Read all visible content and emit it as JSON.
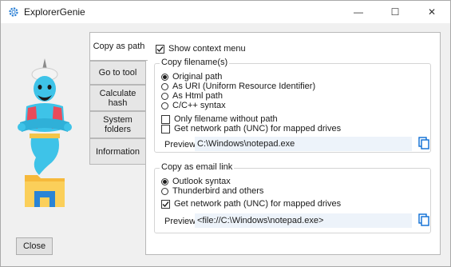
{
  "window": {
    "title": "ExplorerGenie",
    "minimize_glyph": "—",
    "maximize_glyph": "☐",
    "close_glyph": "✕"
  },
  "tabs": [
    {
      "label": "Copy as path",
      "active": true
    },
    {
      "label": "Go to tool",
      "active": false
    },
    {
      "label": "Calculate hash",
      "active": false
    },
    {
      "label": "System folders",
      "active": false
    },
    {
      "label": "Information",
      "active": false
    }
  ],
  "show_context_menu": {
    "label": "Show context menu",
    "checked": true
  },
  "copy_filename": {
    "title": "Copy filename(s)",
    "options": [
      {
        "label": "Original path",
        "selected": true
      },
      {
        "label": "As URI (Uniform Resource Identifier)",
        "selected": false
      },
      {
        "label": "As Html path",
        "selected": false
      },
      {
        "label": "C/C++ syntax",
        "selected": false
      }
    ],
    "only_filename": {
      "label": "Only filename without path",
      "checked": false
    },
    "network_path": {
      "label": "Get network path (UNC) for mapped drives",
      "checked": false
    },
    "preview_label": "Preview",
    "preview_value": "C:\\Windows\\notepad.exe"
  },
  "copy_email": {
    "title": "Copy as email link",
    "options": [
      {
        "label": "Outlook syntax",
        "selected": true
      },
      {
        "label": "Thunderbird and others",
        "selected": false
      }
    ],
    "network_path": {
      "label": "Get network path (UNC) for mapped drives",
      "checked": true
    },
    "preview_label": "Preview",
    "preview_value": "<file://C:\\Windows\\notepad.exe>"
  },
  "close_button": {
    "label": "Close"
  },
  "colors": {
    "accent": "#0a6cd4",
    "preview_bg": "#edf3fa",
    "genie_skin": "#3ec3e8"
  }
}
